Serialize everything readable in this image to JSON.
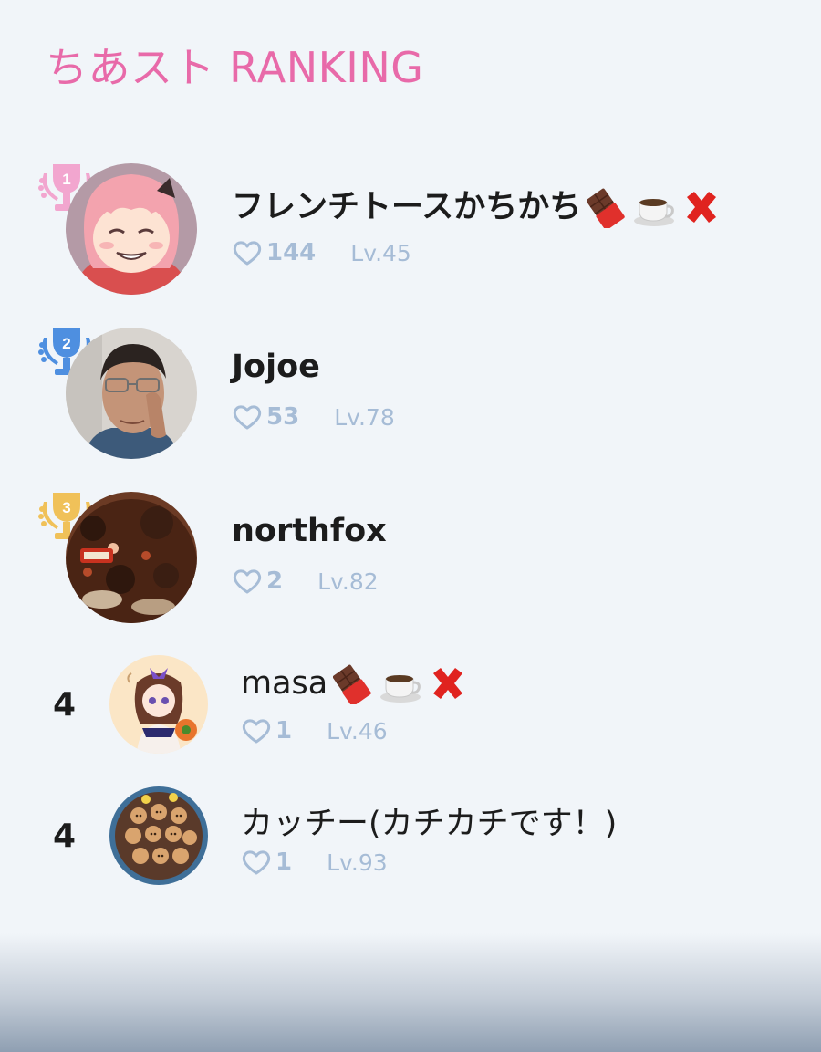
{
  "header": {
    "title": "ちあスト RANKING"
  },
  "colors": {
    "title": "#e86aa9",
    "trophy_1": "#f2a6cf",
    "trophy_2": "#4e8fe0",
    "trophy_3": "#f0c159",
    "meta": "#a6bcd6"
  },
  "rankings": [
    {
      "rank": "1",
      "name": "フレンチトースかちかち",
      "emoji": [
        "chocolate-bar",
        "coffee-cup",
        "red-cross-mark"
      ],
      "likes": "144",
      "level": "Lv.45",
      "avatar": "pink-haired-anime-girl"
    },
    {
      "rank": "2",
      "name": "Jojoe",
      "emoji": [],
      "likes": "53",
      "level": "Lv.78",
      "avatar": "man-with-glasses-photo"
    },
    {
      "rank": "3",
      "name": "northfox",
      "emoji": [],
      "likes": "2",
      "level": "Lv.82",
      "avatar": "chocolate-cake-photo"
    },
    {
      "rank": "4",
      "name": "masa",
      "emoji": [
        "chocolate-bar",
        "coffee-cup",
        "red-cross-mark"
      ],
      "likes": "1",
      "level": "Lv.46",
      "avatar": "anime-girl-illustration"
    },
    {
      "rank": "4",
      "name": "カッチー(カチカチです！)",
      "emoji": [],
      "likes": "1",
      "level": "Lv.93",
      "avatar": "bear-cookies-photo"
    }
  ]
}
